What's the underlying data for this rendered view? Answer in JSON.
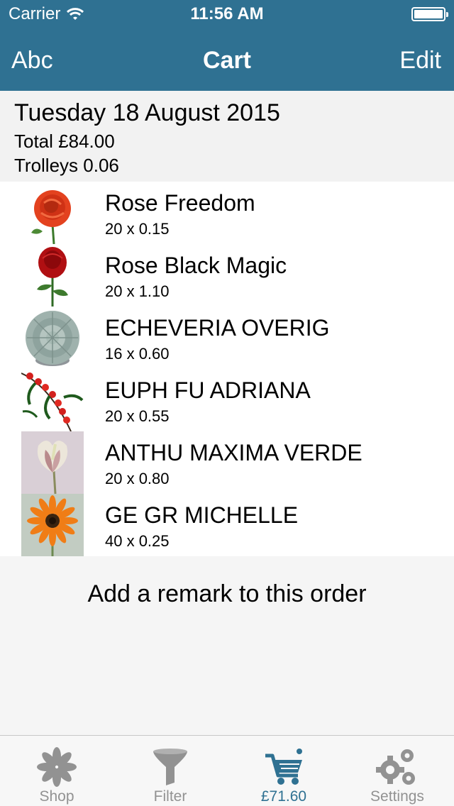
{
  "status": {
    "carrier": "Carrier",
    "time": "11:56 AM"
  },
  "nav": {
    "left": "Abc",
    "title": "Cart",
    "right": "Edit"
  },
  "summary": {
    "date": "Tuesday 18 August 2015",
    "total": "Total £84.00",
    "trolleys": "Trolleys 0.06"
  },
  "items": [
    {
      "name": "Rose Freedom",
      "qty": "20 x 0.15",
      "image": "red-rose"
    },
    {
      "name": "Rose Black Magic",
      "qty": "20 x 1.10",
      "image": "dark-red-rose"
    },
    {
      "name": "ECHEVERIA OVERIG",
      "qty": "16 x 0.60",
      "image": "succulent"
    },
    {
      "name": "EUPH FU ADRIANA",
      "qty": "20 x 0.55",
      "image": "red-euphorbia"
    },
    {
      "name": "ANTHU MAXIMA VERDE",
      "qty": "20 x 0.80",
      "image": "anthurium"
    },
    {
      "name": "GE GR MICHELLE",
      "qty": "40 x 0.25",
      "image": "orange-gerbera"
    }
  ],
  "remark": {
    "label": "Add a remark to this order"
  },
  "tabs": [
    {
      "label": "Shop",
      "icon": "flower-icon"
    },
    {
      "label": "Filter",
      "icon": "funnel-icon"
    },
    {
      "label": "£71.60",
      "icon": "cart-icon",
      "active": true
    },
    {
      "label": "Settings",
      "icon": "gears-icon"
    }
  ],
  "colors": {
    "accent": "#2f7192",
    "tab_inactive": "#929292"
  }
}
